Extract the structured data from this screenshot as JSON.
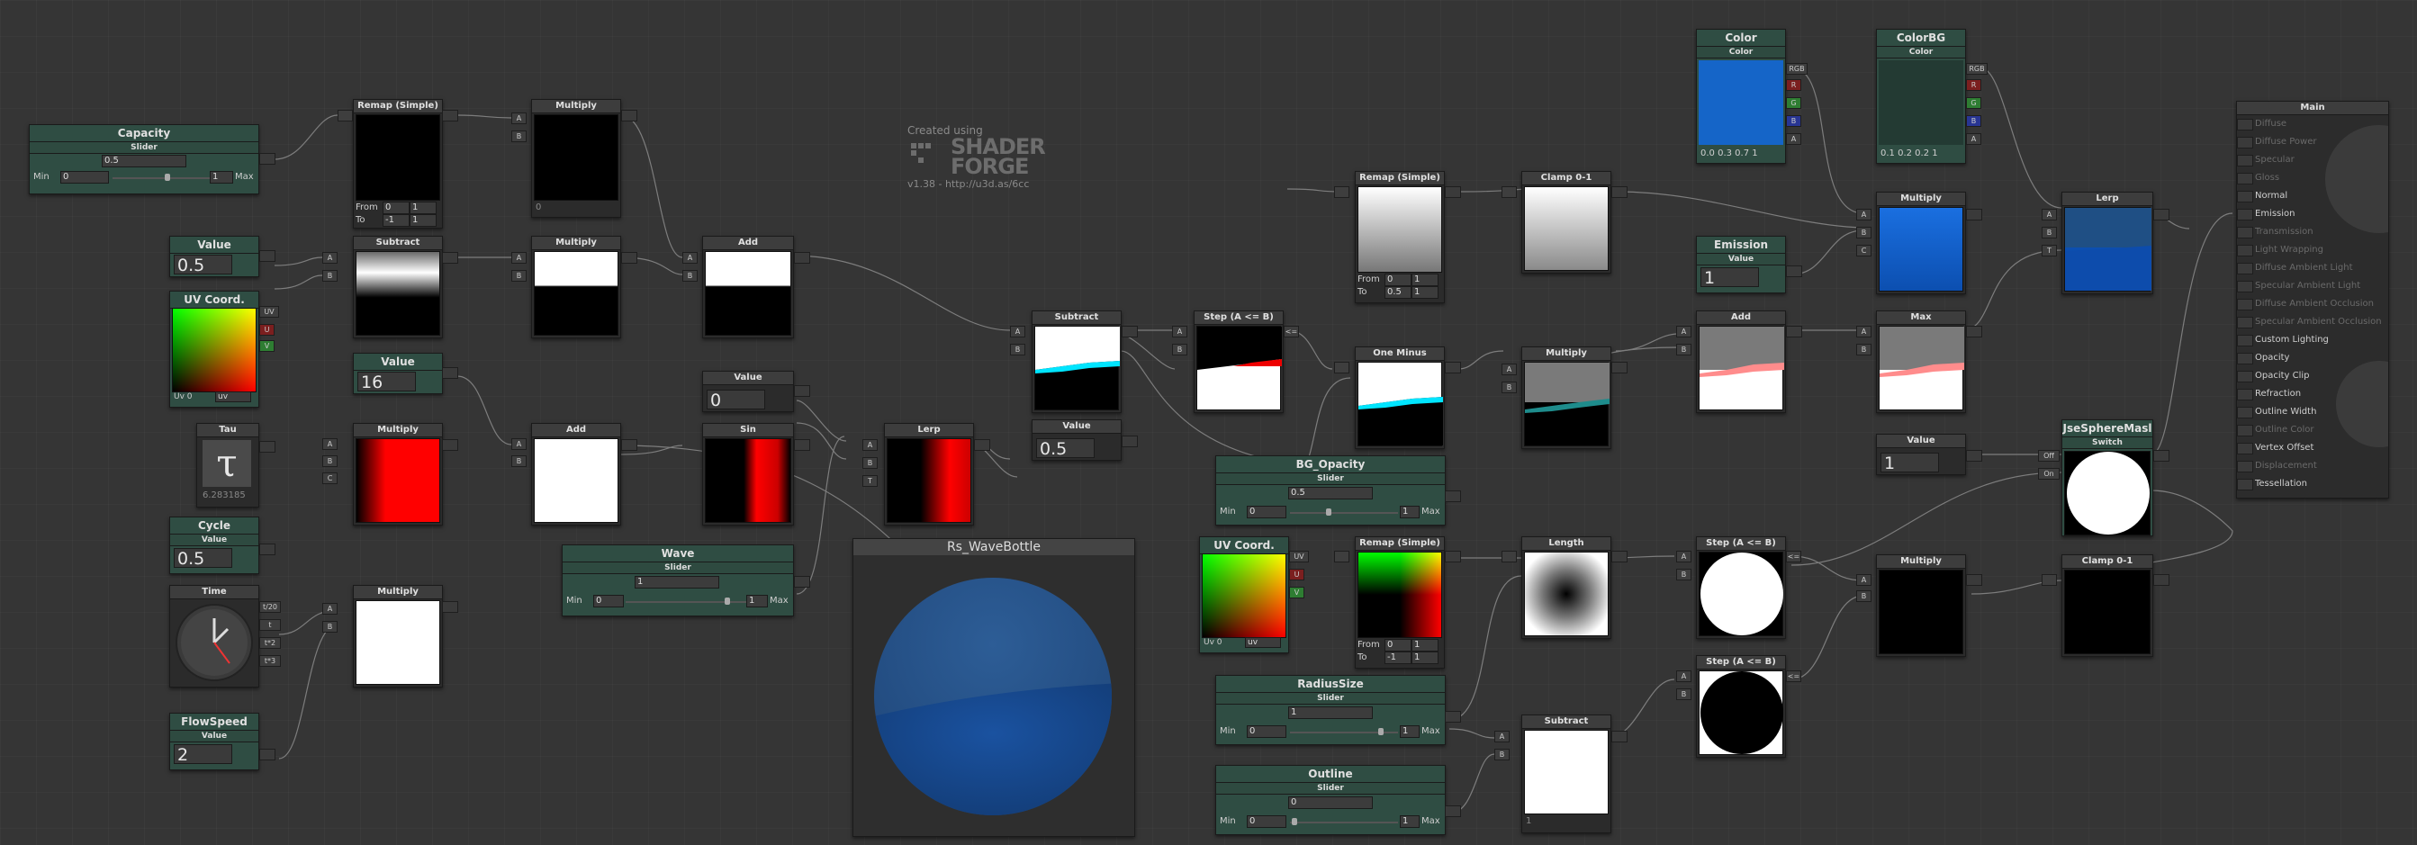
{
  "watermark": {
    "line1": "Created using",
    "brand1": "SHADER",
    "brand2": "FORGE",
    "version": "v1.38 - http://u3d.as/6cc"
  },
  "colors": {
    "accent": "#2f4d43",
    "green": "#2e7d32",
    "red": "#7b1f1f",
    "blue": "#283593",
    "blueColor": "#1565c0",
    "teal": "#00bcd4"
  },
  "nodes": {
    "capacity": {
      "title": "Capacity",
      "sub": "Slider",
      "value": "0.5",
      "min_label": "Min",
      "min": "0",
      "max": "1",
      "max_label": "Max"
    },
    "remap1": {
      "title": "Remap (Simple)",
      "from_label": "From",
      "from_a": "0",
      "from_b": "1",
      "to_label": "To",
      "to_a": "-1",
      "to_b": "1"
    },
    "multiply1": {
      "title": "Multiply",
      "footer": "0"
    },
    "value1": {
      "title": "Value",
      "value": "0.5"
    },
    "uvcoord1": {
      "title": "UV Coord.",
      "uv_label": "Uv 0",
      "uv_sel": "uv"
    },
    "subtract1": {
      "title": "Subtract"
    },
    "multiply2": {
      "title": "Multiply"
    },
    "add1": {
      "title": "Add"
    },
    "value16": {
      "title": "Value",
      "value": "16"
    },
    "value0": {
      "title": "Value",
      "value": "0"
    },
    "tau": {
      "title": "Tau",
      "value": "6.283185"
    },
    "multiply3": {
      "title": "Multiply"
    },
    "add2": {
      "title": "Add"
    },
    "sin": {
      "title": "Sin"
    },
    "lerp1": {
      "title": "Lerp"
    },
    "cycle": {
      "title": "Cycle",
      "sub": "Value",
      "value": "0.5"
    },
    "time": {
      "title": "Time",
      "outs": [
        "t/20",
        "t",
        "t*2",
        "t*3"
      ]
    },
    "multiply4": {
      "title": "Multiply"
    },
    "flowspeed": {
      "title": "FlowSpeed",
      "sub": "Value",
      "value": "2"
    },
    "wave": {
      "title": "Wave",
      "sub": "Slider",
      "value": "1",
      "min_label": "Min",
      "min": "0",
      "max": "1",
      "max_label": "Max"
    },
    "subtract2": {
      "title": "Subtract"
    },
    "value05": {
      "title": "Value",
      "value": "0.5"
    },
    "step1": {
      "title": "Step (A <= B)"
    },
    "remap2": {
      "title": "Remap (Simple)",
      "from_label": "From",
      "from_a": "0",
      "from_b": "1",
      "to_label": "To",
      "to_a": "0.5",
      "to_b": "1"
    },
    "clamp1": {
      "title": "Clamp 0-1"
    },
    "oneminus": {
      "title": "One Minus"
    },
    "multiply5": {
      "title": "Multiply"
    },
    "bgopacity": {
      "title": "BG_Opacity",
      "sub": "Slider",
      "value": "0.5",
      "min_label": "Min",
      "min": "0",
      "max": "1",
      "max_label": "Max"
    },
    "uvcoord2": {
      "title": "UV Coord.",
      "uv_label": "Uv 0",
      "uv_sel": "uv"
    },
    "remap3": {
      "title": "Remap (Simple)",
      "from_label": "From",
      "from_a": "0",
      "from_b": "1",
      "to_label": "To",
      "to_a": "-1",
      "to_b": "1"
    },
    "length": {
      "title": "Length"
    },
    "radiussize": {
      "title": "RadiusSize",
      "sub": "Slider",
      "value": "1",
      "min_label": "Min",
      "min": "0",
      "max": "1",
      "max_label": "Max"
    },
    "subtract3": {
      "title": "Subtract",
      "footer": "1"
    },
    "outline": {
      "title": "Outline",
      "sub": "Slider",
      "value": "0",
      "min_label": "Min",
      "min": "0",
      "max": "1",
      "max_label": "Max"
    },
    "color": {
      "title": "Color",
      "sub": "Color",
      "rgba": "0.0  0.3  0.7  1"
    },
    "colorbg": {
      "title": "ColorBG",
      "sub": "Color",
      "rgba": "0.1  0.2  0.2  1"
    },
    "emission": {
      "title": "Emission",
      "sub": "Value",
      "value": "1"
    },
    "add3": {
      "title": "Add"
    },
    "max": {
      "title": "Max"
    },
    "multiply6": {
      "title": "Multiply"
    },
    "lerp2": {
      "title": "Lerp"
    },
    "step2": {
      "title": "Step (A <= B)"
    },
    "step3": {
      "title": "Step (A <= B)"
    },
    "multiply7": {
      "title": "Multiply"
    },
    "value1b": {
      "title": "Value",
      "value": "1"
    },
    "switch": {
      "title": "JseSphereMasl",
      "sub": "Switch",
      "off": "Off",
      "on": "On"
    },
    "clamp2": {
      "title": "Clamp 0-1"
    },
    "rswave": {
      "title": "Rs_WaveBottle"
    }
  },
  "ports": {
    "a": "A",
    "b": "B",
    "c": "C",
    "t": "T",
    "rgb": "RGB",
    "r": "R",
    "g": "G",
    "bb": "B",
    "aa": "A",
    "uv": "UV",
    "u": "U",
    "v": "V",
    "le": "<="
  },
  "main": {
    "title": "Main",
    "items": [
      {
        "label": "Diffuse",
        "active": false
      },
      {
        "label": "Diffuse Power",
        "active": false
      },
      {
        "label": "Specular",
        "active": false
      },
      {
        "label": "Gloss",
        "active": false
      },
      {
        "label": "Normal",
        "active": true
      },
      {
        "label": "Emission",
        "active": true
      },
      {
        "label": "Transmission",
        "active": false
      },
      {
        "label": "Light Wrapping",
        "active": false
      },
      {
        "label": "Diffuse Ambient Light",
        "active": false
      },
      {
        "label": "Specular Ambient Light",
        "active": false
      },
      {
        "label": "Diffuse Ambient Occlusion",
        "active": false
      },
      {
        "label": "Specular Ambient Occlusion",
        "active": false
      },
      {
        "label": "Custom Lighting",
        "active": true
      },
      {
        "label": "Opacity",
        "active": true
      },
      {
        "label": "Opacity Clip",
        "active": true
      },
      {
        "label": "Refraction",
        "active": true
      },
      {
        "label": "Outline Width",
        "active": true
      },
      {
        "label": "Outline Color",
        "active": false
      },
      {
        "label": "Vertex Offset",
        "active": true
      },
      {
        "label": "Displacement",
        "active": false
      },
      {
        "label": "Tessellation",
        "active": true
      }
    ]
  }
}
